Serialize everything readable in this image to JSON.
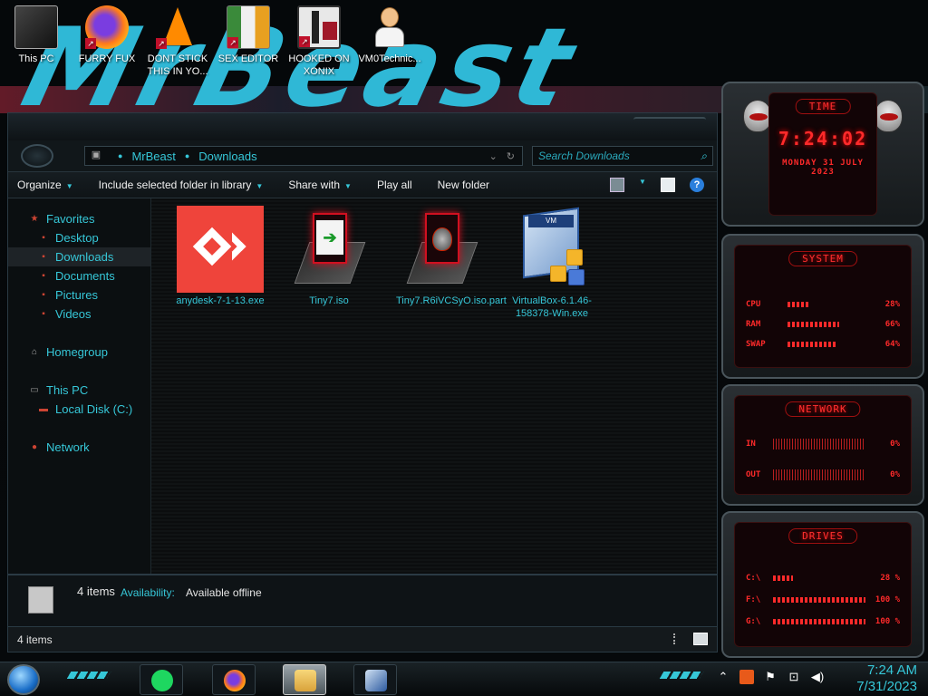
{
  "desktop": {
    "wallpaper_text": "MrBeast",
    "icons": [
      {
        "label": "This PC"
      },
      {
        "label": "FURRY FUX"
      },
      {
        "label": "DONT STICK THIS IN YO..."
      },
      {
        "label": "SEX EDITOR"
      },
      {
        "label": "HOOKED ON XONIX"
      },
      {
        "label": "VM0Technic..."
      }
    ]
  },
  "explorer": {
    "address": {
      "crumbs": [
        "MrBeast",
        "Downloads"
      ]
    },
    "search": {
      "placeholder": "Search Downloads"
    },
    "toolbar": {
      "organize": "Organize",
      "include_library": "Include selected folder in library",
      "share_with": "Share with",
      "play_all": "Play all",
      "new_folder": "New folder"
    },
    "nav": {
      "favorites": "Favorites",
      "desktop": "Desktop",
      "downloads": "Downloads",
      "documents": "Documents",
      "pictures": "Pictures",
      "videos": "Videos",
      "homegroup": "Homegroup",
      "this_pc": "This PC",
      "local_disk": "Local Disk (C:)",
      "network": "Network"
    },
    "files": [
      {
        "name": "anydesk-7-1-13.exe",
        "icon": "anydesk-icon"
      },
      {
        "name": "Tiny7.iso",
        "icon": "iso-file-icon"
      },
      {
        "name": "Tiny7.R6iVCSyO.iso.part",
        "icon": "partial-download-icon"
      },
      {
        "name": "VirtualBox-6.1.46-158378-Win.exe",
        "icon": "virtualbox-icon"
      }
    ],
    "details": {
      "count": "4 items",
      "availability_label": "Availability:",
      "availability_value": "Available offline"
    },
    "status": "4 items"
  },
  "gadgets": {
    "time": {
      "title": "TIME",
      "clock": "7:24:02",
      "date": "MONDAY 31 JULY 2023"
    },
    "system": {
      "title": "SYSTEM",
      "rows": [
        {
          "key": "CPU",
          "value": "28%",
          "level": 0.28
        },
        {
          "key": "RAM",
          "value": "66%",
          "level": 0.66
        },
        {
          "key": "SWAP",
          "value": "64%",
          "level": 0.64
        }
      ]
    },
    "network": {
      "title": "NETWORK",
      "rows": [
        {
          "key": "IN",
          "value": "0%"
        },
        {
          "key": "OUT",
          "value": "0%"
        }
      ]
    },
    "drives": {
      "title": "DRIVES",
      "rows": [
        {
          "key": "C:\\",
          "value": "28 %"
        },
        {
          "key": "F:\\",
          "value": "100 %"
        },
        {
          "key": "G:\\",
          "value": "100 %"
        }
      ]
    }
  },
  "taskbar": {
    "time": "7:24 AM",
    "date": "7/31/2023"
  },
  "colors": {
    "accent": "#36c7d8",
    "gadget_red": "#ff2a2a"
  }
}
